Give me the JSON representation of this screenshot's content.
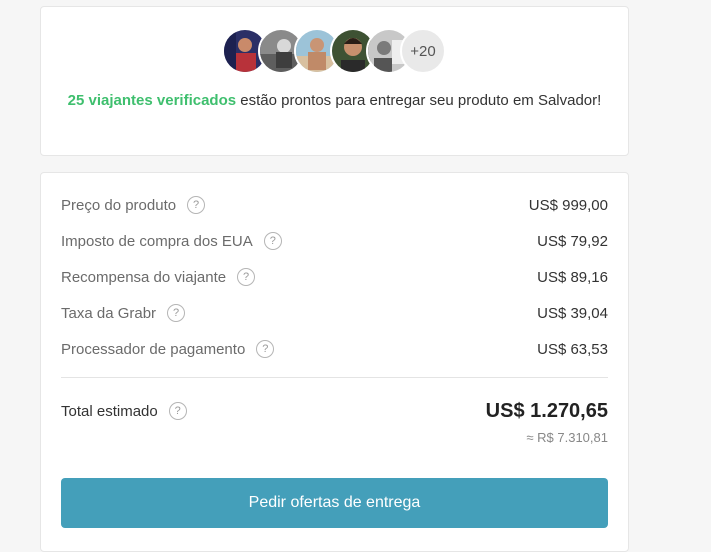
{
  "travelers": {
    "avatars": [
      {
        "name": "traveler-avatar-1",
        "color": "#3a3f7a"
      },
      {
        "name": "traveler-avatar-2",
        "color": "#7d7d7d"
      },
      {
        "name": "traveler-avatar-3",
        "color": "#c9a58b"
      },
      {
        "name": "traveler-avatar-4",
        "color": "#4a5a3c"
      },
      {
        "name": "traveler-avatar-5",
        "color": "#b8b8b8"
      }
    ],
    "more_count": "+20",
    "highlight": "25 viajantes verificados",
    "message": " estão prontos para entregar seu produto em Salvador!"
  },
  "pricing": {
    "rows": [
      {
        "label": "Preço do produto",
        "value": "US$ 999,00"
      },
      {
        "label": "Imposto de compra dos EUA",
        "value": "US$ 79,92"
      },
      {
        "label": "Recompensa do viajante",
        "value": "US$ 89,16"
      },
      {
        "label": "Taxa da Grabr",
        "value": "US$ 39,04"
      },
      {
        "label": "Processador de pagamento",
        "value": "US$ 63,53"
      }
    ],
    "help_glyph": "?",
    "total_label": "Total estimado",
    "total_value": "US$ 1.270,65",
    "converted_value": "≈ R$ 7.310,81",
    "cta_label": "Pedir ofertas de entrega"
  },
  "colors": {
    "highlight_green": "#3fbf6e",
    "button_blue": "#449fba"
  }
}
